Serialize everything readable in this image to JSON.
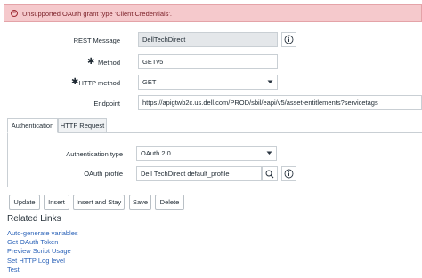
{
  "error": {
    "icon": "close-circle-icon",
    "message": "Unsupported OAuth grant type 'Client Credentials'."
  },
  "form": {
    "rest_message_label": "REST Message",
    "rest_message_value": "DellTechDirect",
    "method_label": "Method",
    "method_value": "GETv5",
    "http_method_label": "HTTP method",
    "http_method_value": "GET",
    "endpoint_label": "Endpoint",
    "endpoint_value": "https://apigtwb2c.us.dell.com/PROD/sbil/eapi/v5/asset-entitlements?servicetags",
    "required_marker": "✱"
  },
  "tabs": [
    {
      "label": "Authentication",
      "active": true
    },
    {
      "label": "HTTP Request",
      "active": false
    }
  ],
  "auth": {
    "auth_type_label": "Authentication type",
    "auth_type_value": "OAuth 2.0",
    "oauth_profile_label": "OAuth profile",
    "oauth_profile_value": "Dell TechDirect default_profile"
  },
  "buttons": {
    "update": "Update",
    "insert": "Insert",
    "insert_and_stay": "Insert and Stay",
    "save": "Save",
    "delete": "Delete"
  },
  "related_links": {
    "title": "Related Links",
    "items": [
      "Auto-generate variables",
      "Get OAuth Token",
      "Preview Script Usage",
      "Set HTTP Log level",
      "Test"
    ]
  },
  "colors": {
    "error_bg": "#f5c9cc",
    "link": "#2a62b8",
    "readonly_bg": "#e4e7ea"
  }
}
